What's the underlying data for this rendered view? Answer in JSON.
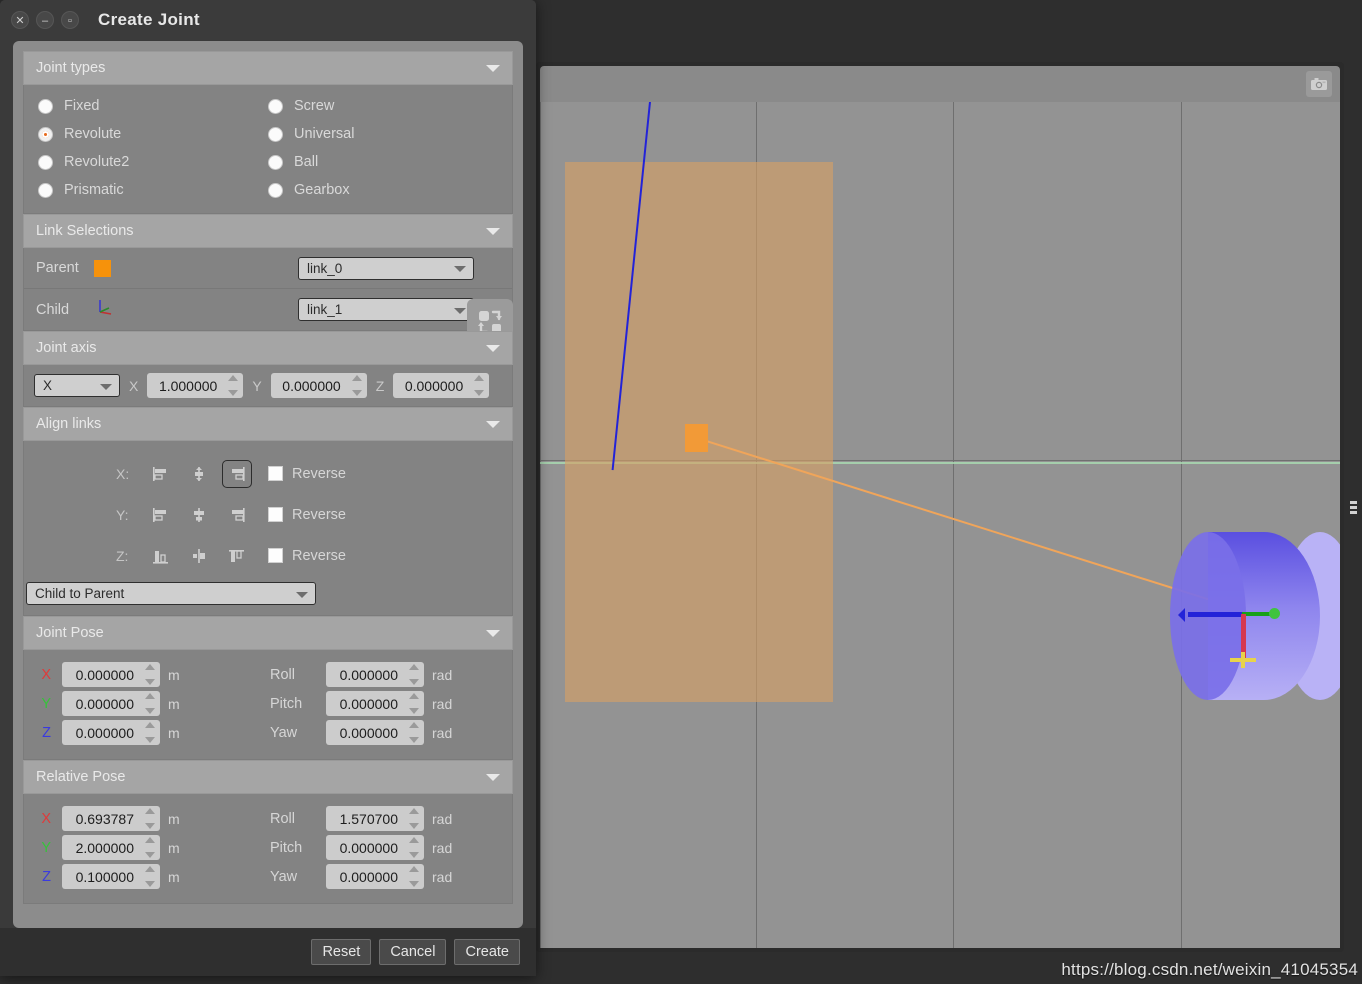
{
  "window": {
    "title": "Create Joint",
    "close_icon": "close-icon",
    "minimize_icon": "minimize-icon",
    "maximize_icon": "maximize-icon"
  },
  "joint_types": {
    "header": "Joint types",
    "selected": "Revolute",
    "left_column": [
      "Fixed",
      "Revolute",
      "Revolute2",
      "Prismatic"
    ],
    "right_column": [
      "Screw",
      "Universal",
      "Ball",
      "Gearbox"
    ]
  },
  "link_selections": {
    "header": "Link Selections",
    "parent_label": "Parent",
    "parent_value": "link_0",
    "parent_swatch_color": "#f6920b",
    "child_label": "Child",
    "child_value": "link_1",
    "swap_icon": "swap-links-icon"
  },
  "joint_axis": {
    "header": "Joint axis",
    "preset": "X",
    "x_label": "X",
    "x_value": "1.000000",
    "y_label": "Y",
    "y_value": "0.000000",
    "z_label": "Z",
    "z_value": "0.000000"
  },
  "align_links": {
    "header": "Align links",
    "rows": [
      {
        "axis": "X:",
        "buttons": [
          "align-x-min-icon",
          "align-x-center-icon",
          "align-x-max-icon"
        ],
        "focused_index": 2,
        "reverse_label": "Reverse",
        "reverse_checked": false
      },
      {
        "axis": "Y:",
        "buttons": [
          "align-y-min-icon",
          "align-y-center-icon",
          "align-y-max-icon"
        ],
        "focused_index": -1,
        "reverse_label": "Reverse",
        "reverse_checked": false
      },
      {
        "axis": "Z:",
        "buttons": [
          "align-z-min-icon",
          "align-z-center-icon",
          "align-z-max-icon"
        ],
        "focused_index": -1,
        "reverse_label": "Reverse",
        "reverse_checked": false
      }
    ],
    "target_mode": "Child to Parent"
  },
  "joint_pose": {
    "header": "Joint Pose",
    "rows": [
      {
        "axis": "X",
        "value": "0.000000",
        "unit": "m",
        "rot_label": "Roll",
        "rot_value": "0.000000",
        "rot_unit": "rad"
      },
      {
        "axis": "Y",
        "value": "0.000000",
        "unit": "m",
        "rot_label": "Pitch",
        "rot_value": "0.000000",
        "rot_unit": "rad"
      },
      {
        "axis": "Z",
        "value": "0.000000",
        "unit": "m",
        "rot_label": "Yaw",
        "rot_value": "0.000000",
        "rot_unit": "rad"
      }
    ]
  },
  "relative_pose": {
    "header": "Relative Pose",
    "rows": [
      {
        "axis": "X",
        "value": "0.693787",
        "unit": "m",
        "rot_label": "Roll",
        "rot_value": "1.570700",
        "rot_unit": "rad"
      },
      {
        "axis": "Y",
        "value": "2.000000",
        "unit": "m",
        "rot_label": "Pitch",
        "rot_value": "0.000000",
        "rot_unit": "rad"
      },
      {
        "axis": "Z",
        "value": "0.100000",
        "unit": "m",
        "rot_label": "Yaw",
        "rot_value": "0.000000",
        "rot_unit": "rad"
      }
    ]
  },
  "footer": {
    "reset_label": "Reset",
    "cancel_label": "Cancel",
    "create_label": "Create"
  },
  "viewport": {
    "camera_icon": "camera-screenshot-icon",
    "splitter_icon": "splitter-handle-icon",
    "parent_link_color": "#d6a064",
    "child_link_color": "#8e85ee",
    "joint_handle_color": "#f29a37"
  },
  "watermark": "https://blog.csdn.net/weixin_41045354"
}
